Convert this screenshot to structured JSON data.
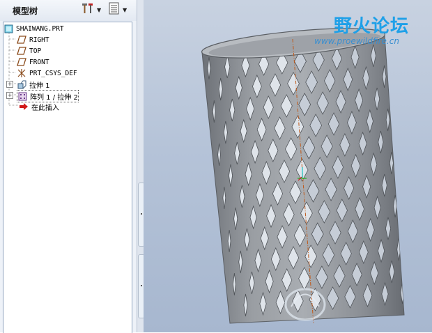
{
  "model_tree": {
    "title": "模型树",
    "items": [
      {
        "label": "SHAIWANG.PRT",
        "icon": "part-icon"
      },
      {
        "label": "RIGHT",
        "icon": "datum-plane-icon"
      },
      {
        "label": "TOP",
        "icon": "datum-plane-icon"
      },
      {
        "label": "FRONT",
        "icon": "datum-plane-icon"
      },
      {
        "label": "PRT_CSYS_DEF",
        "icon": "csys-icon"
      },
      {
        "label": "拉伸 1",
        "icon": "extrude-icon"
      },
      {
        "label": "阵列 1 / 拉伸 2",
        "icon": "pattern-icon"
      },
      {
        "label": "在此插入",
        "icon": "insert-here-arrow-icon"
      }
    ]
  },
  "toolbar": {
    "settings_icon": "tools-icon",
    "show_icon": "list-icon"
  },
  "watermark": {
    "title": "野火论坛",
    "url": "www.proewildfire.cn"
  },
  "colors": {
    "viewport_bg": "#b5c3d8",
    "model_gray": "#8f9297",
    "axis_line": "#c05a1a",
    "watermark_blue": "#1ea0e8"
  }
}
